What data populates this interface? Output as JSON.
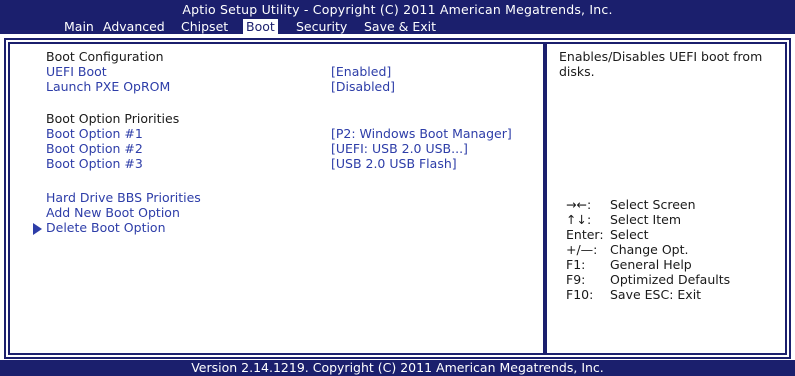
{
  "title": "Aptio Setup Utility - Copyright (C) 2011 American Megatrends, Inc.",
  "menu": [
    "Main",
    "Advanced",
    "Chipset",
    "Boot",
    "Security",
    "Save & Exit"
  ],
  "active_menu": "Boot",
  "main": {
    "boot_config_heading": "Boot Configuration",
    "uefi_boot": {
      "label": "UEFI Boot",
      "value": "[Enabled]"
    },
    "launch_pxe": {
      "label": "Launch PXE OpROM",
      "value": "[Disabled]"
    },
    "priorities_heading": "Boot Option Priorities",
    "boot_options": [
      {
        "label": "Boot Option #1",
        "value": "[P2:  Windows Boot Manager]"
      },
      {
        "label": "Boot Option #2",
        "value": "[UEFI: USB 2.0 USB...]"
      },
      {
        "label": "Boot Option #3",
        "value": "[USB 2.0 USB Flash]"
      }
    ],
    "hdd_bbs": "Hard Drive BBS Priorities",
    "add_boot": "Add New Boot Option",
    "delete_boot": "Delete Boot Option"
  },
  "help": {
    "description_line1": "Enables/Disables UEFI boot from",
    "description_line2": "disks.",
    "keys": [
      {
        "key": "→←:",
        "action": "Select Screen"
      },
      {
        "key": "↑↓:",
        "action": "Select Item"
      },
      {
        "key": "Enter:",
        "action": "Select"
      },
      {
        "key": "+/—:",
        "action": "Change Opt."
      },
      {
        "key": "F1:",
        "action": "General Help"
      },
      {
        "key": "F9:",
        "action": "Optimized Defaults"
      },
      {
        "key": "F10:",
        "action": "Save    ESC:  Exit"
      }
    ]
  },
  "status": "Version 2.14.1219. Copyright (C) 2011 American Megatrends, Inc.",
  "colors": {
    "navy": "#1b1f6d",
    "item_blue": "#2d3da8",
    "text": "#1a1a1a"
  }
}
